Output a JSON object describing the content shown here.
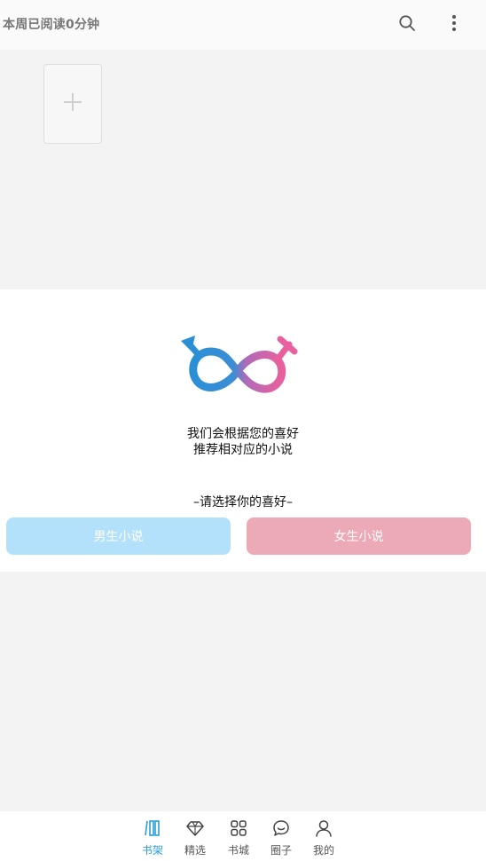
{
  "header": {
    "reading_stat": "本周已阅读0分钟",
    "search_icon": "search-icon",
    "more_icon": "more-vertical-icon"
  },
  "shelf": {
    "add_icon": "plus-icon"
  },
  "preference": {
    "logo": "gender-symbols-icon",
    "message_line1": "我们会根据您的喜好",
    "message_line2": "推荐相对应的小说",
    "prompt": "–请选择你的喜好–",
    "male_label": "男生小说",
    "female_label": "女生小说",
    "colors": {
      "male": "#b3e1fb",
      "female": "#eca9b6",
      "logo_blue": "#2b8fd6",
      "logo_pink": "#e9609e"
    }
  },
  "tabbar": {
    "active": "书架",
    "active_color": "#2a9fd8",
    "items": [
      {
        "label": "书架",
        "icon": "bookshelf-icon"
      },
      {
        "label": "精选",
        "icon": "diamond-icon"
      },
      {
        "label": "书城",
        "icon": "grid-icon"
      },
      {
        "label": "圈子",
        "icon": "chat-bubble-icon"
      },
      {
        "label": "我的",
        "icon": "person-icon"
      }
    ]
  }
}
